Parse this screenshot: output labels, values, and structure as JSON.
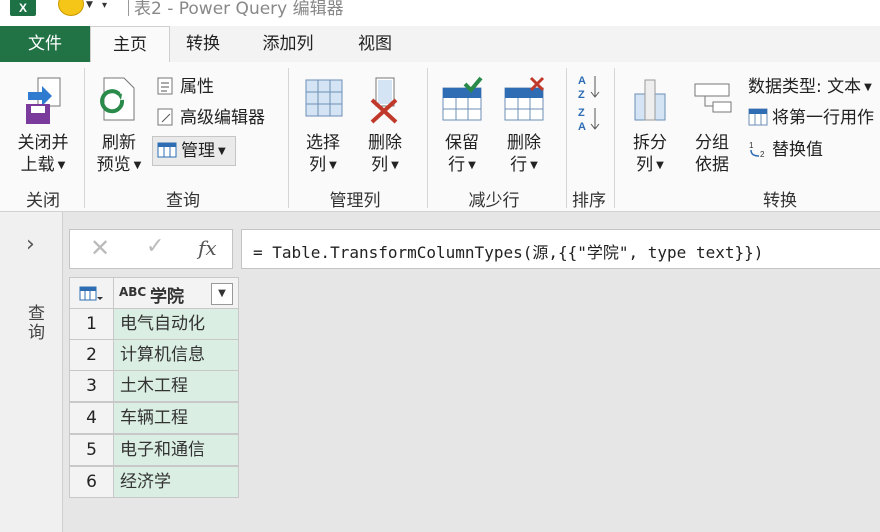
{
  "titlebar": {
    "logo_text": "X",
    "title": "表2 - Power Query 编辑器"
  },
  "tabs": {
    "file": "文件",
    "home": "主页",
    "transform": "转换",
    "add_column": "添加列",
    "view": "视图"
  },
  "ribbon": {
    "close_group": {
      "label": "关闭",
      "close_load": [
        "关闭并",
        "上载"
      ]
    },
    "query_group": {
      "label": "查询",
      "refresh_preview": [
        "刷新",
        "预览"
      ],
      "properties": "属性",
      "advanced_editor": "高级编辑器",
      "manage": "管理"
    },
    "manage_columns_group": {
      "label": "管理列",
      "choose_columns": [
        "选择",
        "列"
      ],
      "remove_columns": [
        "删除",
        "列"
      ]
    },
    "reduce_rows_group": {
      "label": "减少行",
      "keep_rows": [
        "保留",
        "行"
      ],
      "remove_rows": [
        "删除",
        "行"
      ]
    },
    "sort_group": {
      "label": "排序"
    },
    "transform_group": {
      "label": "转换",
      "split_column": [
        "拆分",
        "列"
      ],
      "group_by": [
        "分组",
        "依据"
      ],
      "data_type": "数据类型: 文本",
      "use_first_row": "将第一行用作",
      "replace_values": "替换值"
    }
  },
  "query_pane": {
    "label": "查询"
  },
  "formula_bar": {
    "fx": "fx",
    "formula": "= Table.TransformColumnTypes(源,{{\"学院\", type text}})"
  },
  "table": {
    "column": {
      "type_icon": "ABC",
      "name": "学院"
    },
    "rows": [
      {
        "num": "1",
        "value": "电气自动化"
      },
      {
        "num": "2",
        "value": "计算机信息"
      },
      {
        "num": "3",
        "value": "土木工程"
      },
      {
        "num": "4",
        "value": "车辆工程"
      },
      {
        "num": "5",
        "value": "电子和通信"
      },
      {
        "num": "6",
        "value": "经济学"
      }
    ]
  },
  "colors": {
    "accent": "#217346",
    "cell_fill": "#daeee3"
  }
}
